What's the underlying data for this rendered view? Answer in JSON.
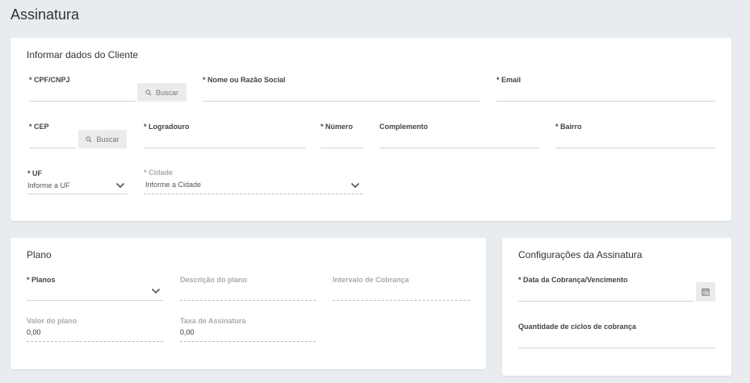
{
  "page": {
    "title": "Assinatura"
  },
  "cliente": {
    "title": "Informar dados do Cliente",
    "cpf_label": "* CPF/CNPJ",
    "buscar_label": "Buscar",
    "nome_label": "* Nome ou Razão Social",
    "email_label": "* Email",
    "cep_label": "* CEP",
    "logradouro_label": "* Logradouro",
    "numero_label": "* Número",
    "complemento_label": "Complemento",
    "bairro_label": "* Bairro",
    "uf_label": "* UF",
    "uf_value": "Informe a UF",
    "cidade_label": "* Cidade",
    "cidade_value": "Informe a Cidade"
  },
  "plano": {
    "title": "Plano",
    "planos_label": "* Planos",
    "descricao_label": "Descrição do plano",
    "intervalo_label": "Intervalo de Cobrança",
    "valor_label": "Valor do plano",
    "valor_value": "0,00",
    "taxa_label": "Taxa de Assinatura",
    "taxa_value": "0,00"
  },
  "config": {
    "title": "Configurações da Assinatura",
    "data_label": "* Data da Cobrança/Vencimento",
    "ciclos_label": "Quantidade de ciclos de cobrança"
  },
  "icons": {
    "search": "search-icon",
    "chevron": "chevron-down-icon",
    "calendar": "calendar-icon"
  }
}
